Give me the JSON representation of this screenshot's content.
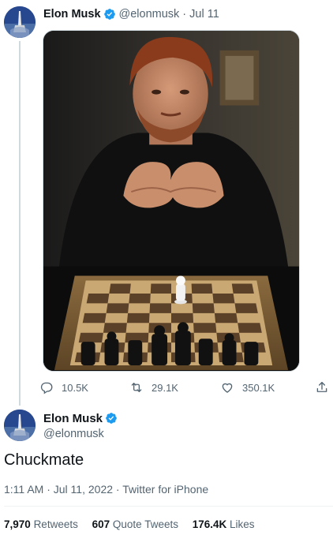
{
  "author": {
    "name": "Elon Musk",
    "handle": "@elonmusk"
  },
  "reply_tweet": {
    "separator": "·",
    "date": "Jul 11",
    "media_alt": "Chuck Norris with a chessboard",
    "actions": {
      "reply_count": "10.5K",
      "retweet_count": "29.1K",
      "like_count": "350.1K"
    }
  },
  "main_tweet": {
    "text": "Chuckmate",
    "timestamp": "1:11 AM · Jul 11, 2022 · ",
    "source": "Twitter for iPhone",
    "stats": {
      "retweets": {
        "value": "7,970",
        "label": "Retweets"
      },
      "quote_tweets": {
        "value": "607",
        "label": "Quote Tweets"
      },
      "likes": {
        "value": "176.4K",
        "label": "Likes"
      }
    }
  },
  "colors": {
    "verified": "#1d9bf0",
    "secondary_text": "#536471",
    "primary_text": "#0f1419"
  }
}
